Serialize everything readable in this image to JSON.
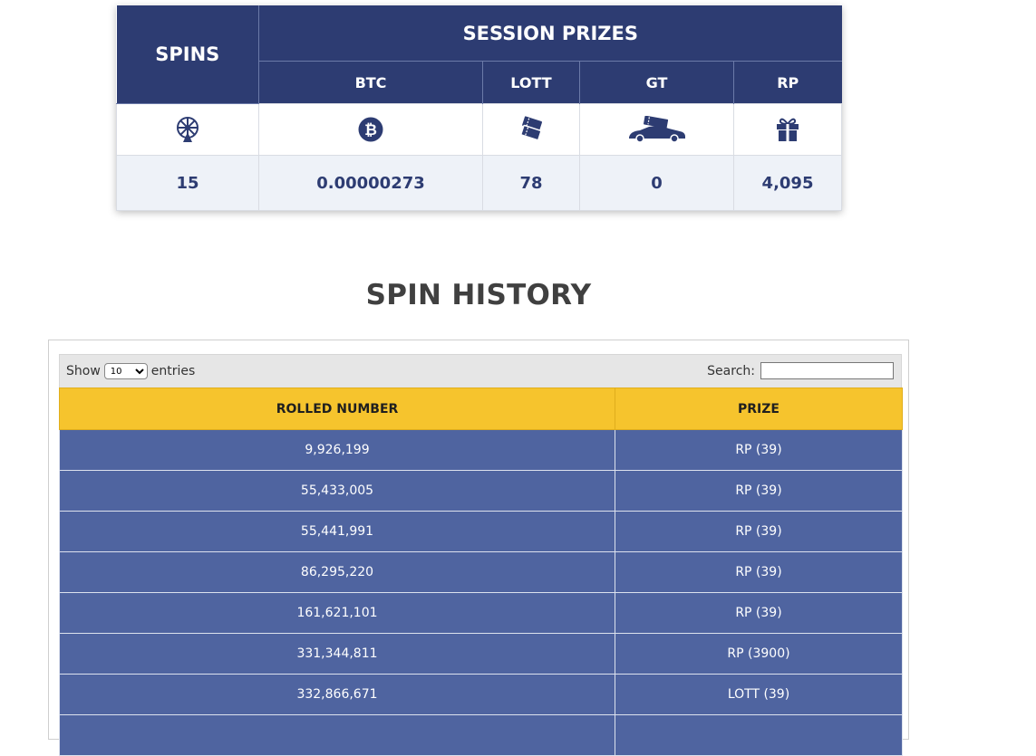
{
  "session": {
    "spins_header": "SPINS",
    "prizes_header": "SESSION PRIZES",
    "columns": [
      "BTC",
      "LOTT",
      "GT",
      "RP"
    ],
    "icons": [
      "wheel-icon",
      "bitcoin-icon",
      "tickets-icon",
      "car-ticket-icon",
      "gift-icon"
    ],
    "values": {
      "spins": "15",
      "btc": "0.00000273",
      "lott": "78",
      "gt": "0",
      "rp": "4,095"
    },
    "colors": {
      "header": "#2d3c72",
      "value_row": "#eef2f8"
    }
  },
  "history": {
    "title": "SPIN HISTORY",
    "show_label": "Show",
    "entries_value": "10",
    "entries_label": "entries",
    "search_label": "Search:",
    "search_value": "",
    "columns": [
      "ROLLED NUMBER",
      "PRIZE"
    ],
    "rows": [
      [
        "9,926,199",
        "RP (39)"
      ],
      [
        "55,433,005",
        "RP (39)"
      ],
      [
        "55,441,991",
        "RP (39)"
      ],
      [
        "86,295,220",
        "RP (39)"
      ],
      [
        "161,621,101",
        "RP (39)"
      ],
      [
        "331,344,811",
        "RP (3900)"
      ],
      [
        "332,866,671",
        "LOTT (39)"
      ],
      [
        "",
        ""
      ]
    ],
    "colors": {
      "header": "#f6c42d",
      "row": "#4f64a0"
    }
  }
}
